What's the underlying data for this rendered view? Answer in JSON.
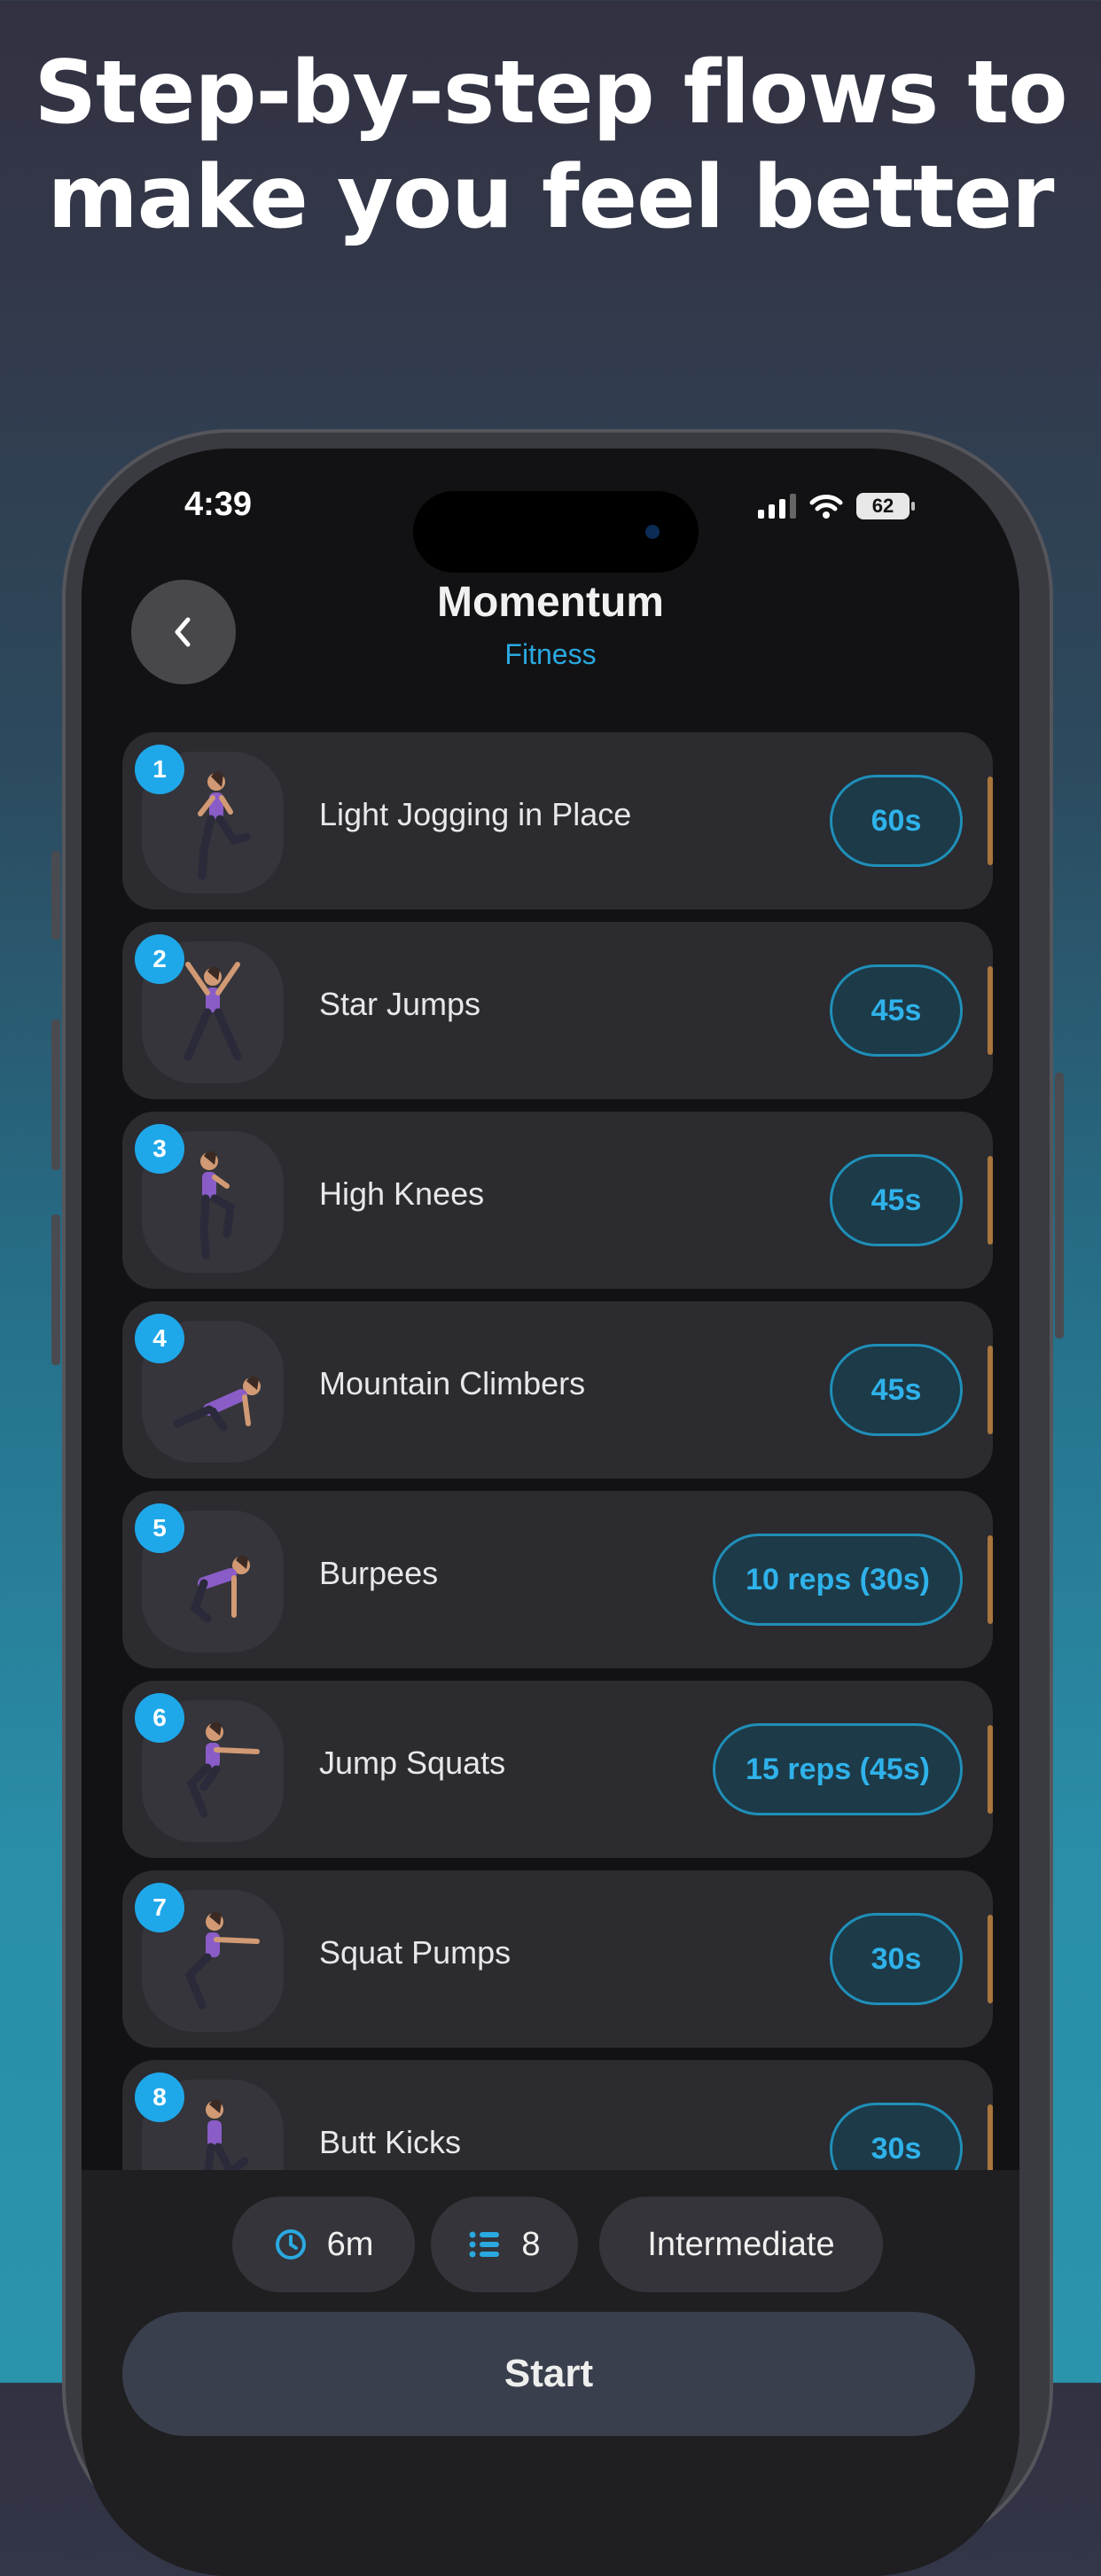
{
  "headline": {
    "line1": "Step-by-step flows to",
    "line2": "make you feel better"
  },
  "status_bar": {
    "time": "4:39",
    "battery": "62"
  },
  "nav": {
    "title": "Momentum",
    "subtitle": "Fitness"
  },
  "exercises": [
    {
      "number": "1",
      "name": "Light Jogging in Place",
      "duration": "60s"
    },
    {
      "number": "2",
      "name": "Star Jumps",
      "duration": "45s"
    },
    {
      "number": "3",
      "name": "High Knees",
      "duration": "45s"
    },
    {
      "number": "4",
      "name": "Mountain Climbers",
      "duration": "45s"
    },
    {
      "number": "5",
      "name": "Burpees",
      "duration": "10 reps (30s)"
    },
    {
      "number": "6",
      "name": "Jump Squats",
      "duration": "15 reps (45s)"
    },
    {
      "number": "7",
      "name": "Squat Pumps",
      "duration": "30s"
    },
    {
      "number": "8",
      "name": "Butt Kicks",
      "duration": "30s"
    }
  ],
  "summary": {
    "duration": "6m",
    "count": "8",
    "level": "Intermediate"
  },
  "start_label": "Start",
  "colors": {
    "accent": "#1ea8ea",
    "row_bg": "#2b2b30",
    "screen_bg": "#121214",
    "bar": "#a8763c"
  }
}
